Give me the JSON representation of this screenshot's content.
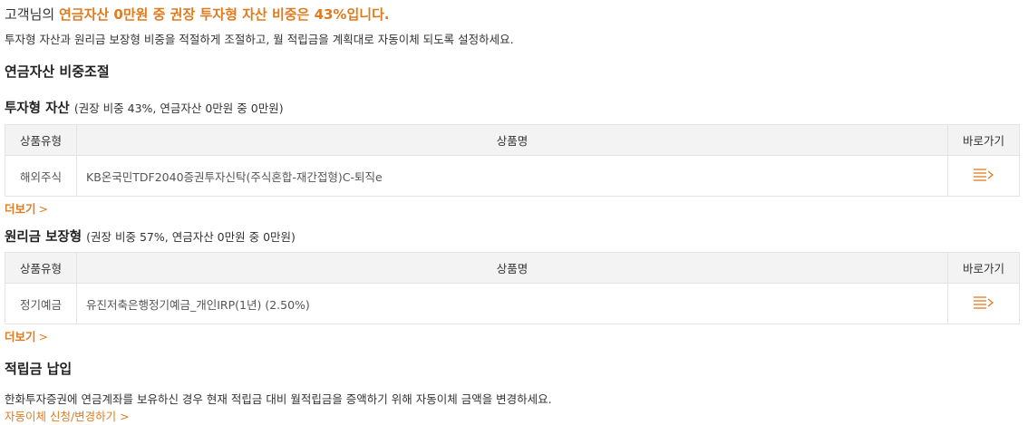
{
  "headline": {
    "prefix": "고객님의 ",
    "highlight": "연금자산 0만원 중 권장 투자형 자산 비중은 43%입니다."
  },
  "subline": "투자형 자산과 원리금 보장형 비중을 적절하게 조절하고, 월 적립금을 계획대로 자동이체 되도록 설정하세요.",
  "rebalance": {
    "title": "연금자산 비중조절"
  },
  "investment": {
    "title": "투자형 자산",
    "note": "(권장 비중 43%, 연금자산 0만원 중 0만원)",
    "headers": {
      "type": "상품유형",
      "name": "상품명",
      "go": "바로가기"
    },
    "rows": [
      {
        "type": "해외주식",
        "name": "KB온국민TDF2040증권투자신탁(주식혼합-재간접형)C-퇴직e"
      }
    ],
    "more": "더보기",
    "more_chevron": ">"
  },
  "guaranteed": {
    "title": "원리금 보장형",
    "note": "(권장 비중 57%, 연금자산 0만원 중 0만원)",
    "headers": {
      "type": "상품유형",
      "name": "상품명",
      "go": "바로가기"
    },
    "rows": [
      {
        "type": "정기예금",
        "name": "유진저축은행정기예금_개인IRP(1년) (2.50%)"
      }
    ],
    "more": "더보기",
    "more_chevron": ">"
  },
  "savings": {
    "title": "적립금 납입",
    "desc": "한화투자증권에 연금계좌를 보유하신 경우 현재 적립금 대비 월적립금을 증액하기 위해 자동이체 금액을 변경하세요.",
    "link": "자동이체 신청/변경하기",
    "link_chevron": ">"
  },
  "icons": {
    "go_icon": "list-arrow-icon"
  },
  "colors": {
    "accent": "#e07b1f",
    "header_bg": "#f3f3f3",
    "icon": "#e07b1f"
  }
}
